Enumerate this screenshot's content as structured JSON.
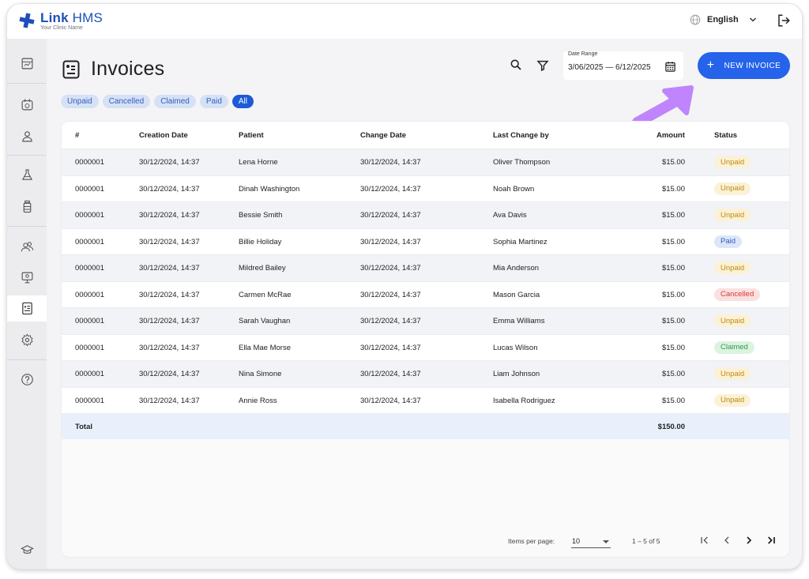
{
  "app": {
    "name": "Link HMS",
    "name_bold": "Link",
    "name_thin": " HMS",
    "subtitle": "Your Clinic Name"
  },
  "header": {
    "language": "English"
  },
  "sidebar": {
    "items": [
      "dashboard-icon",
      "calendar-icon",
      "person-icon",
      "lab-flask-icon",
      "medicine-bottle-icon",
      "users-icon",
      "monitor-icon",
      "invoice-icon",
      "settings-icon",
      "help-icon",
      "graduation-cap-icon"
    ],
    "active": "invoice-icon"
  },
  "page": {
    "title": "Invoices"
  },
  "toolbar": {
    "date_range_label": "Date Range",
    "date_range_value": "3/06/2025 — 6/12/2025",
    "new_invoice_label": "NEW INVOICE"
  },
  "filters": [
    {
      "label": "Unpaid",
      "active": false
    },
    {
      "label": "Cancelled",
      "active": false
    },
    {
      "label": "Claimed",
      "active": false
    },
    {
      "label": "Paid",
      "active": false
    },
    {
      "label": "All",
      "active": true
    }
  ],
  "table": {
    "columns": [
      "#",
      "Creation Date",
      "Patient",
      "Change Date",
      "Last Change by",
      "Amount",
      "Status"
    ],
    "rows": [
      {
        "id": "0000001",
        "created": "30/12/2024, 14:37",
        "patient": "Lena Horne",
        "changed": "30/12/2024, 14:37",
        "by": "Oliver Thompson",
        "amount": "$15.00",
        "status": "Unpaid"
      },
      {
        "id": "0000001",
        "created": "30/12/2024, 14:37",
        "patient": "Dinah Washington",
        "changed": "30/12/2024, 14:37",
        "by": "Noah Brown",
        "amount": "$15.00",
        "status": "Unpaid"
      },
      {
        "id": "0000001",
        "created": "30/12/2024, 14:37",
        "patient": "Bessie Smith",
        "changed": "30/12/2024, 14:37",
        "by": "Ava Davis",
        "amount": "$15.00",
        "status": "Unpaid"
      },
      {
        "id": "0000001",
        "created": "30/12/2024, 14:37",
        "patient": "Billie Holiday",
        "changed": "30/12/2024, 14:37",
        "by": "Sophia Martinez",
        "amount": "$15.00",
        "status": "Paid"
      },
      {
        "id": "0000001",
        "created": "30/12/2024, 14:37",
        "patient": "Mildred Bailey",
        "changed": "30/12/2024, 14:37",
        "by": "Mia Anderson",
        "amount": "$15.00",
        "status": "Unpaid"
      },
      {
        "id": "0000001",
        "created": "30/12/2024, 14:37",
        "patient": "Carmen McRae",
        "changed": "30/12/2024, 14:37",
        "by": "Mason Garcia",
        "amount": "$15.00",
        "status": "Cancelled"
      },
      {
        "id": "0000001",
        "created": "30/12/2024, 14:37",
        "patient": "Sarah Vaughan",
        "changed": "30/12/2024, 14:37",
        "by": "Emma Williams",
        "amount": "$15.00",
        "status": "Unpaid"
      },
      {
        "id": "0000001",
        "created": "30/12/2024, 14:37",
        "patient": "Ella Mae Morse",
        "changed": "30/12/2024, 14:37",
        "by": "Lucas Wilson",
        "amount": "$15.00",
        "status": "Claimed"
      },
      {
        "id": "0000001",
        "created": "30/12/2024, 14:37",
        "patient": "Nina Simone",
        "changed": "30/12/2024, 14:37",
        "by": "Liam Johnson",
        "amount": "$15.00",
        "status": "Unpaid"
      },
      {
        "id": "0000001",
        "created": "30/12/2024, 14:37",
        "patient": "Annie Ross",
        "changed": "30/12/2024, 14:37",
        "by": "Isabella Rodriguez",
        "amount": "$15.00",
        "status": "Unpaid"
      }
    ],
    "total_label": "Total",
    "total_amount": "$150.00"
  },
  "pagination": {
    "items_per_page_label": "Items per page:",
    "items_per_page": "10",
    "range": "1 – 5 of 5"
  },
  "colors": {
    "accent": "#2563eb",
    "arrow": "#c084fc"
  }
}
